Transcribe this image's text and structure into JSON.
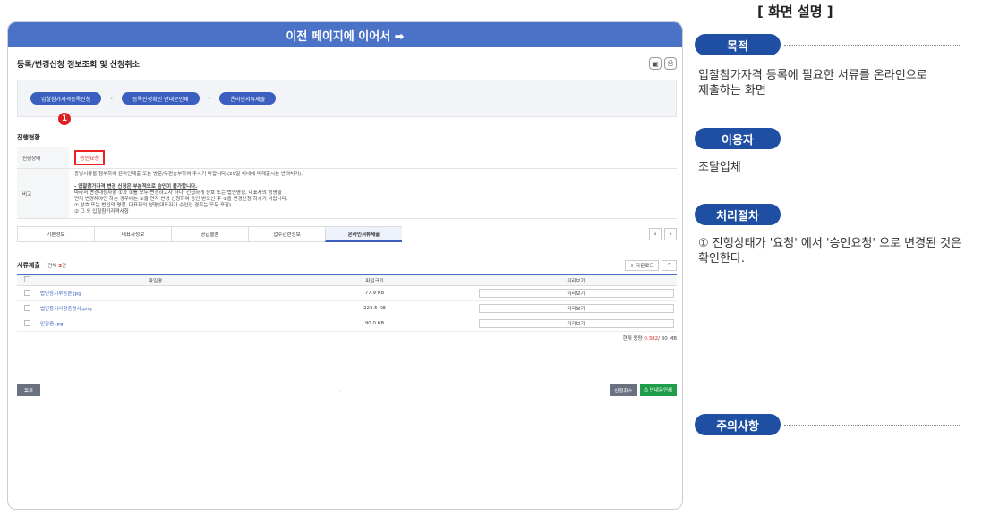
{
  "banner": {
    "title": "이전 페이지에 이어서 ➡"
  },
  "page": {
    "title": "등록/변경신청 정보조회 및 신청취소",
    "icon_save": "save-icon",
    "icon_print": "print-icon"
  },
  "steps": [
    {
      "label": "입찰참가자격등록신청"
    },
    {
      "label": "등록신청확인 안내문인쇄"
    },
    {
      "label": "온라인서류제출"
    }
  ],
  "status_section": {
    "label": "진행현황",
    "status_header": "진행상태",
    "status_value": "승인요청",
    "remarks_header": "비고",
    "marker": "1",
    "notes": [
      "증빙서류를 첨부하여 온라인제출 또는 방문/우편송부하여 주시기 바랍니다.(20일 이내에 미제출시는 반려처리).",
      "",
      "- 입찰참가자격 변경 신청은 부분적으로 승인이 불가합니다.",
      "  따라서 변경대상사항 ①과 ②를 모두 변경하고자 하나, 긴급하게 상호 또는 법인명칭, 대표자의 성명을",
      "  먼저 변경해야만 하는 경우에는 ①을 먼저 변경 신청하여 승인 받으신 후 ②를 변경신청 하시기 바랍니다.",
      "  ① 상호 또는 법인의 명칭, 대표자의 성명(대표자가 수인인 경우는 모두 포함)",
      "  ② 그 외 입찰참가자격사항"
    ]
  },
  "tabs": [
    {
      "label": "기본정보"
    },
    {
      "label": "대표자정보"
    },
    {
      "label": "공급물품"
    },
    {
      "label": "업수관련정보"
    },
    {
      "label": "온라인서류제출"
    }
  ],
  "docs": {
    "title": "서류제출",
    "count_prefix": "전체",
    "count": "3",
    "count_suffix": "건",
    "download_label": "⇩ 다운로드",
    "collapse_label": "^",
    "columns": [
      "파일명",
      "파일크기",
      "미리보기"
    ],
    "rows": [
      {
        "name": "법인등기부등본.jpg",
        "size": "77.9 KB",
        "preview": "미리보기"
      },
      {
        "name": "법인등기사항증명서.png",
        "size": "223.5 KB",
        "preview": "미리보기"
      },
      {
        "name": "인감증.jpg",
        "size": "90.0 KB",
        "preview": "미리보기"
      }
    ],
    "usage_prefix": "현재 용량",
    "usage_value": "0.382",
    "usage_suffix": "/ 30 MB"
  },
  "buttons": {
    "list": "목록",
    "cancel": "신청취소",
    "guide": "⎙ 안내문인쇄"
  },
  "panel": {
    "title": "[ 화면 설명 ]",
    "purpose_label": "목적",
    "purpose_text": "입찰참가자격 등록에 필요한 서류를 온라인으로 제출하는 화면",
    "user_label": "이용자",
    "user_text": "조달업체",
    "process_label": "처리절차",
    "process_text": "① 진행상태가 '요청' 에서 '승인요청' 으로 변경된 것은 확인한다.",
    "caution_label": "주의사항"
  },
  "colors": {
    "banner": "#4a73c8",
    "pill": "#1e4fa3",
    "alert": "#e02020",
    "green": "#1f9d4b"
  }
}
